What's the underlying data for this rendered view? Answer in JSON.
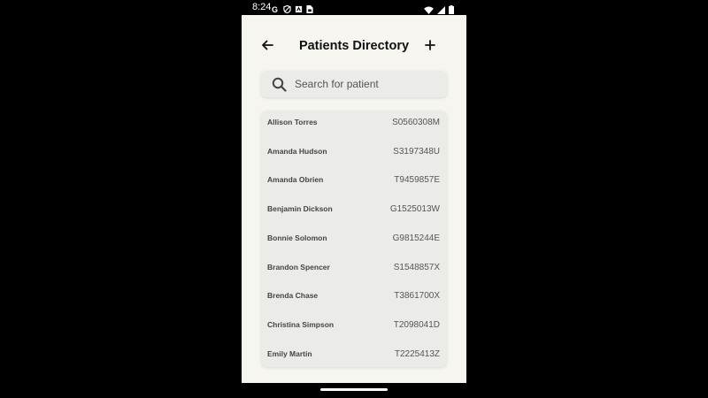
{
  "status_bar": {
    "time": "8:24",
    "left_icons": [
      "google-icon",
      "shield-icon",
      "clipboard-icon",
      "sim-card-icon"
    ],
    "right_icons": [
      "wifi-icon",
      "signal-icon",
      "battery-icon"
    ]
  },
  "header": {
    "title": "Patients Directory",
    "back_icon": "arrow-left-icon",
    "add_icon": "plus-icon"
  },
  "search": {
    "placeholder": "Search for patient",
    "value": ""
  },
  "patients": [
    {
      "name": "Allison Torres",
      "id": "S0560308M"
    },
    {
      "name": "Amanda Hudson",
      "id": "S3197348U"
    },
    {
      "name": "Amanda Obrien",
      "id": "T9459857E"
    },
    {
      "name": "Benjamin Dickson",
      "id": "G1525013W"
    },
    {
      "name": "Bonnie Solomon",
      "id": "G9815244E"
    },
    {
      "name": "Brandon Spencer",
      "id": "S1548857X"
    },
    {
      "name": "Brenda Chase",
      "id": "T3861700X"
    },
    {
      "name": "Christina Simpson",
      "id": "T2098041D"
    },
    {
      "name": "Emily Martin",
      "id": "T2225413Z"
    }
  ],
  "colors": {
    "background": "#000000",
    "screen": "#f6f5f0",
    "card": "#ebebe8",
    "title_text": "#111111"
  }
}
